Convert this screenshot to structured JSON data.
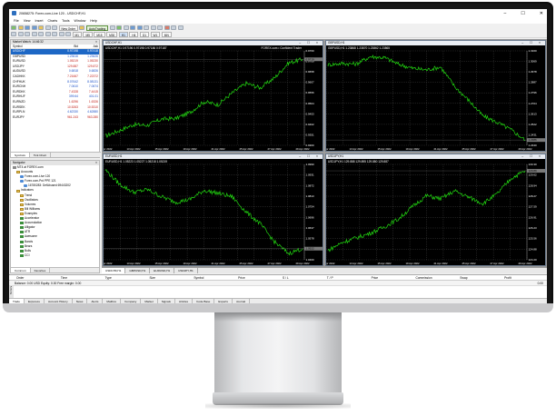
{
  "window": {
    "title": "20658275: Forex.com-Live 120 - USDCHF,H1",
    "controls": [
      "–",
      "☐",
      "✕"
    ]
  },
  "menu": [
    "File",
    "View",
    "Insert",
    "Charts",
    "Tools",
    "Window",
    "Help"
  ],
  "toolbar": {
    "new_order": "New Order",
    "autotrading": "AutoTrading",
    "timeframes": [
      "M1",
      "M5",
      "M15",
      "M30",
      "H1",
      "H4",
      "D1",
      "W1",
      "MN"
    ]
  },
  "market_watch": {
    "title": "Market Watch: 14:46:32",
    "columns": [
      "Symbol",
      "Bid",
      "Ask"
    ],
    "rows": [
      {
        "symbol": "USDCHF",
        "bid": "0.97198",
        "ask": "0.97418",
        "dir": "hl"
      },
      {
        "symbol": "GBPUSD",
        "bid": "1.23616",
        "ask": "1.23626",
        "dir": "up"
      },
      {
        "symbol": "EURUSD",
        "bid": "1.05219",
        "ask": "1.05230",
        "dir": "dn"
      },
      {
        "symbol": "USDJPY",
        "bid": "129.887",
        "ask": "129.872",
        "dir": "dn"
      },
      {
        "symbol": "AUDUSD",
        "bid": "0.6818",
        "ask": "0.6826",
        "dir": "up"
      },
      {
        "symbol": "CADHKK",
        "bid": "7.21667",
        "ask": "7.22372",
        "dir": "dn"
      },
      {
        "symbol": "CHFHUK",
        "bid": "8.07642",
        "ask": "8.08131",
        "dir": "up"
      },
      {
        "symbol": "EURCNH",
        "bid": "7.0610",
        "ask": "7.0674",
        "dir": "up"
      },
      {
        "symbol": "EURDKK",
        "bid": "7.4328",
        "ask": "7.4415",
        "dir": "dn"
      },
      {
        "symbol": "EURHUF",
        "bid": "399.64",
        "ask": "401.01",
        "dir": "up"
      },
      {
        "symbol": "EURNZD",
        "bid": "1.6296",
        "ask": "1.6326",
        "dir": "dn"
      },
      {
        "symbol": "EURSEK",
        "bid": "10.5263",
        "ask": "10.5310",
        "dir": "dn"
      },
      {
        "symbol": "EURPLN",
        "bid": "4.62330",
        "ask": "4.62880",
        "dir": "up"
      },
      {
        "symbol": "EURJPY",
        "bid": "961.243",
        "ask": "963.280",
        "dir": "dn"
      }
    ],
    "tabs": [
      "Symbols",
      "Tick Chart"
    ]
  },
  "navigator": {
    "title": "Navigator",
    "items": [
      {
        "label": "MT4 at FOREX.com",
        "icon": "root",
        "indent": 0
      },
      {
        "label": "Accounts",
        "icon": "folder",
        "indent": 1
      },
      {
        "label": "Forex.com-Live 120",
        "icon": "acct",
        "indent": 2
      },
      {
        "label": "Forex.com-Prd PPE 121",
        "icon": "acct",
        "indent": 2
      },
      {
        "label": "16780283: DefAbused 69443202",
        "icon": "acct",
        "indent": 3
      },
      {
        "label": "Indicators",
        "icon": "folder",
        "indent": 1
      },
      {
        "label": "Trend",
        "icon": "folder",
        "indent": 2
      },
      {
        "label": "Oscillators",
        "icon": "folder",
        "indent": 2
      },
      {
        "label": "Volumes",
        "icon": "folder",
        "indent": 2
      },
      {
        "label": "Bill Williams",
        "icon": "folder",
        "indent": 2
      },
      {
        "label": "Examples",
        "icon": "folder",
        "indent": 2
      },
      {
        "label": "Accelerator",
        "icon": "ind",
        "indent": 2
      },
      {
        "label": "Accumulation",
        "icon": "ind",
        "indent": 2
      },
      {
        "label": "Alligator",
        "icon": "ind",
        "indent": 2
      },
      {
        "label": "ATR",
        "icon": "ind",
        "indent": 2
      },
      {
        "label": "Awesome",
        "icon": "ind",
        "indent": 2
      },
      {
        "label": "Bands",
        "icon": "ind",
        "indent": 2
      },
      {
        "label": "Bears",
        "icon": "ind",
        "indent": 2
      },
      {
        "label": "Bulls",
        "icon": "ind",
        "indent": 2
      },
      {
        "label": "CCI",
        "icon": "ind",
        "indent": 2
      }
    ],
    "tabs": [
      "Common",
      "Favorites"
    ]
  },
  "charts": [
    {
      "title": "USDCHF,H1",
      "info": "USDCHF,H1  0.97196 0.97198 0.97186 0.97187",
      "label": "FOREX.com • Confident Trader"
    },
    {
      "title": "GBPUSD,H1",
      "info": "GBPUSD,H1  1.23868 1.23870 1.23862 1.23865",
      "label": ""
    },
    {
      "title": "EURUSD,H1",
      "info": "EURUSD,H1  1.05223 1.05227 1.05218 1.05219",
      "label": ""
    },
    {
      "title": "USDJPY,H1",
      "info": "USDJPY,H1  129.888 129.895 129.880 129.887",
      "label": ""
    }
  ],
  "chart_tabs": [
    "USDCHF,H1",
    "GBPUSD,H1",
    "EURUSD,H1",
    "USDJPY,H1"
  ],
  "terminal": {
    "columns": [
      "Order",
      "Time",
      "Type",
      "Size",
      "Symbol",
      "Price",
      "S / L",
      "T / P",
      "Price",
      "Commission",
      "Swap",
      "Profit"
    ],
    "balance": "Balance: 0.00 USD  Equity: 0.00  Free margin: 0.00",
    "balance_amount": "0.00",
    "side_label": "Terminal",
    "tabs": [
      "Trade",
      "Exposure",
      "Account History",
      "News",
      "Alerts",
      "Mailbox",
      "Company",
      "Market",
      "Signals",
      "Articles",
      "Code Base",
      "Experts",
      "Journal"
    ]
  },
  "colors": {
    "chart_bg": "#000000",
    "line": "#22d611",
    "grid": "#4d4d4d",
    "highlight": "#1d67c5"
  },
  "chart_data": [
    {
      "type": "line",
      "title": "USDCHF,H1",
      "x": [
        "11 Apr 2022",
        "12 Apr 2022",
        "13 Apr 2022",
        "14 Apr 2022",
        "15 Apr 2022",
        "18 Apr 2022",
        "19 Apr 2022",
        "20 Apr 2022",
        "21 Apr 2022",
        "22 Apr 2022",
        "25 Apr 2022",
        "26 Apr 2022",
        "27 Apr 2022",
        "28 Apr 2022",
        "29 Apr 2022"
      ],
      "series": [
        {
          "name": "USDCHF",
          "values": [
            0.9345,
            0.9372,
            0.9401,
            0.9398,
            0.9428,
            0.9431,
            0.946,
            0.9512,
            0.9498,
            0.9555,
            0.9602,
            0.958,
            0.9628,
            0.9701,
            0.9719
          ]
        }
      ],
      "ylim": [
        0.93,
        0.976
      ]
    },
    {
      "type": "line",
      "title": "GBPUSD,H1",
      "x": [
        "11 Apr 2022",
        "12 Apr 2022",
        "13 Apr 2022",
        "14 Apr 2022",
        "15 Apr 2022",
        "18 Apr 2022",
        "19 Apr 2022",
        "20 Apr 2022",
        "21 Apr 2022",
        "22 Apr 2022",
        "25 Apr 2022",
        "26 Apr 2022",
        "27 Apr 2022",
        "28 Apr 2022",
        "29 Apr 2022"
      ],
      "series": [
        {
          "name": "GBPUSD",
          "values": [
            1.304,
            1.3051,
            1.3046,
            1.311,
            1.3102,
            1.3045,
            1.3009,
            1.2995,
            1.302,
            1.285,
            1.273,
            1.2595,
            1.254,
            1.2475,
            1.2386
          ]
        }
      ],
      "ylim": [
        1.234,
        1.316
      ]
    },
    {
      "type": "line",
      "title": "EURUSD,H1",
      "x": [
        "11 Apr 2022",
        "12 Apr 2022",
        "13 Apr 2022",
        "14 Apr 2022",
        "15 Apr 2022",
        "18 Apr 2022",
        "19 Apr 2022",
        "20 Apr 2022",
        "21 Apr 2022",
        "22 Apr 2022",
        "25 Apr 2022",
        "26 Apr 2022",
        "27 Apr 2022",
        "28 Apr 2022",
        "29 Apr 2022"
      ],
      "series": [
        {
          "name": "EURUSD",
          "values": [
            1.096,
            1.088,
            1.0835,
            1.085,
            1.081,
            1.078,
            1.0795,
            1.0845,
            1.083,
            1.081,
            1.0725,
            1.066,
            1.056,
            1.0495,
            1.0522
          ]
        }
      ],
      "ylim": [
        1.046,
        1.099
      ]
    },
    {
      "type": "line",
      "title": "USDJPY,H1",
      "x": [
        "11 Apr 2022",
        "12 Apr 2022",
        "13 Apr 2022",
        "14 Apr 2022",
        "15 Apr 2022",
        "18 Apr 2022",
        "19 Apr 2022",
        "20 Apr 2022",
        "21 Apr 2022",
        "22 Apr 2022",
        "25 Apr 2022",
        "26 Apr 2022",
        "27 Apr 2022",
        "28 Apr 2022",
        "29 Apr 2022"
      ],
      "series": [
        {
          "name": "USDJPY",
          "values": [
            124.8,
            125.3,
            125.6,
            125.9,
            126.3,
            126.8,
            127.6,
            128.3,
            128.1,
            128.6,
            128.2,
            127.8,
            128.4,
            129.4,
            129.89
          ]
        }
      ],
      "ylim": [
        124.2,
        130.3
      ]
    }
  ]
}
